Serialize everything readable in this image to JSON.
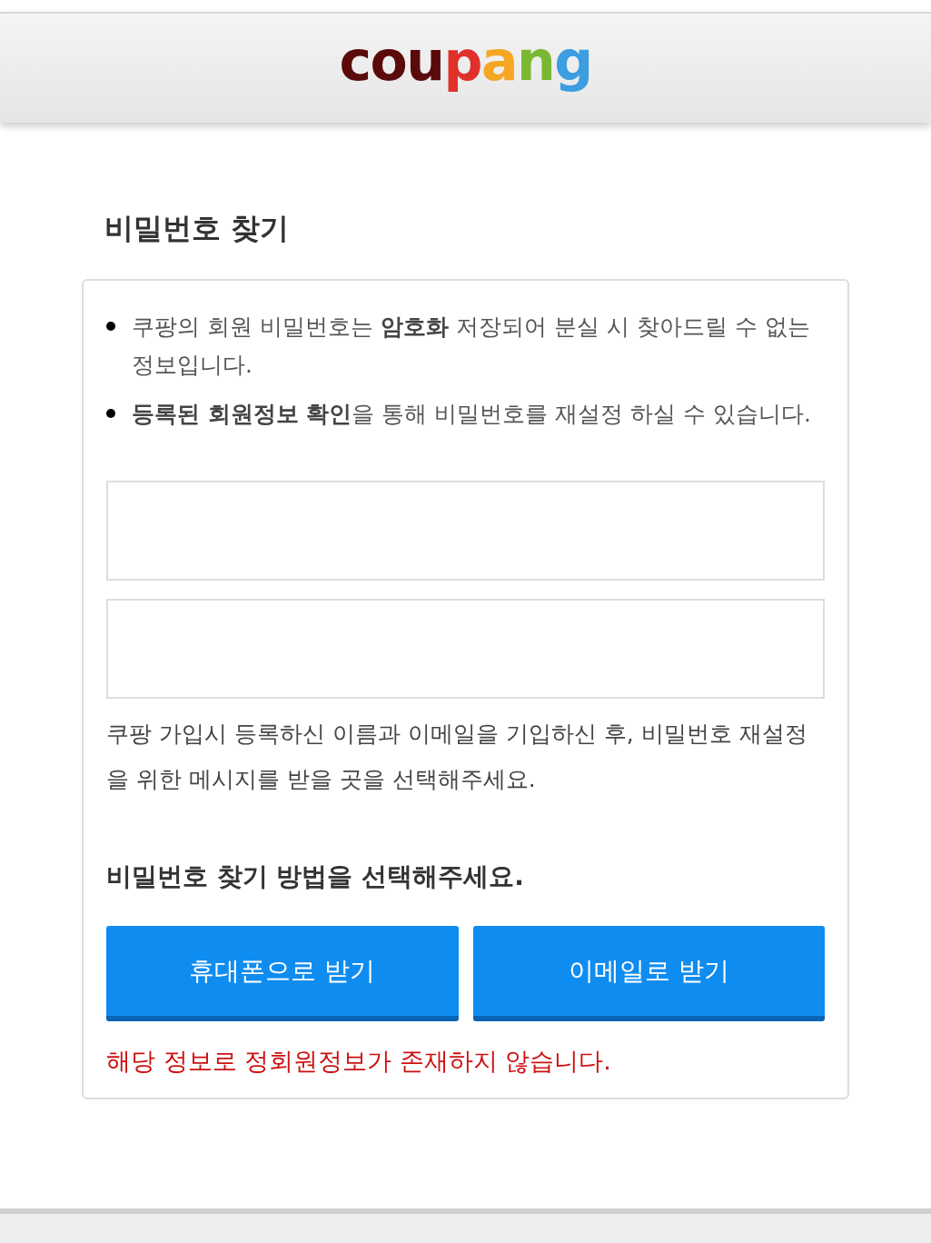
{
  "header": {
    "logo": "coupang"
  },
  "title": "비밀번호 찾기",
  "notices": [
    "쿠팡의 회원 비밀번호는 **암호화** 저장되어 분실 시 찾아드릴 수 없는 정보입니다.",
    "**등록된 회원정보 확인**을 통해 비밀번호를 재설정 하실 수 있습니다."
  ],
  "fields": [
    {
      "kind": "text"
    },
    {
      "kind": "text"
    }
  ],
  "instruction": "쿠팡 가입시 등록하신 이름과 이메일을 기입하신 후, 비밀번호 재설정을 위한 메시지를 받을 곳을 선택해주세요.",
  "method_heading": "비밀번호 찾기 방법을 선택해주세요.",
  "buttons": [
    "휴대폰으로 받기",
    "이메일로 받기"
  ],
  "error": "해당 정보로 정회원정보가 존재하지 않습니다."
}
